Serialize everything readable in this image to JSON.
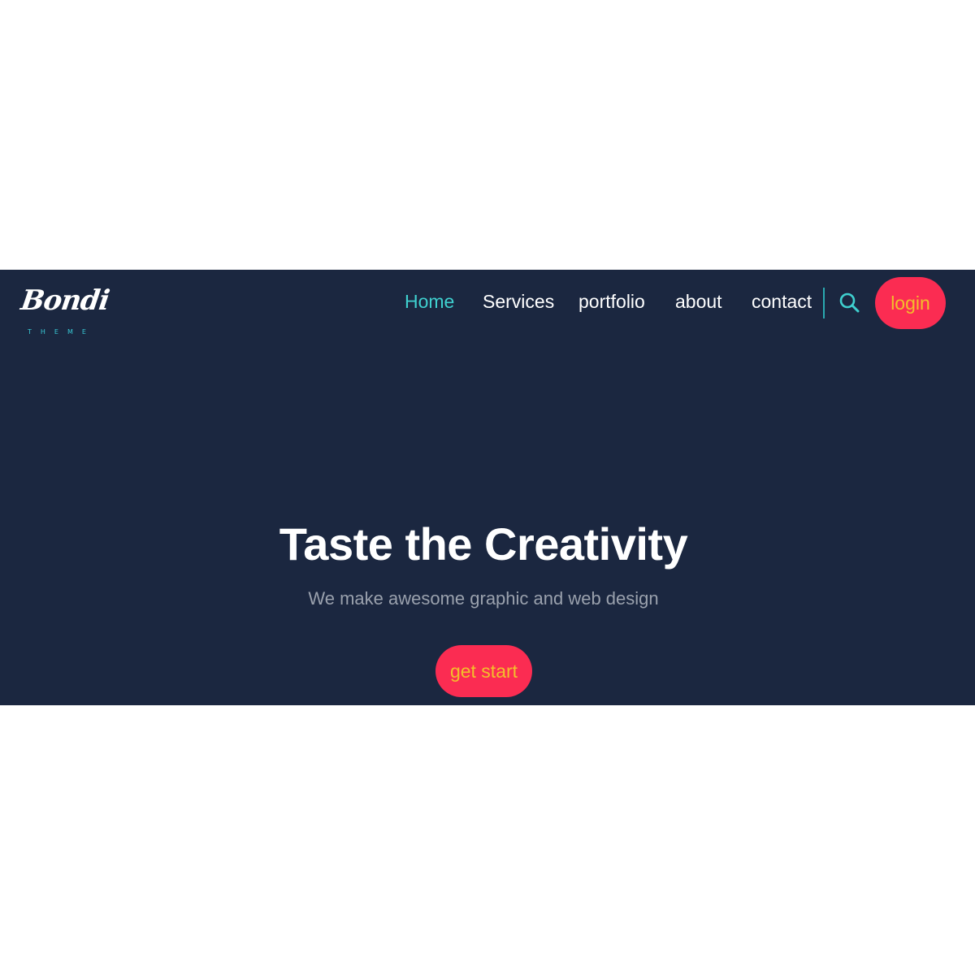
{
  "brand": {
    "name": "Bondi",
    "tagline": "THEME"
  },
  "nav": {
    "items": [
      {
        "label": "Home",
        "active": true
      },
      {
        "label": "Services",
        "active": false
      },
      {
        "label": "portfolio",
        "active": false
      },
      {
        "label": "about",
        "active": false
      },
      {
        "label": "contact",
        "active": false
      }
    ],
    "search_icon": "search-icon",
    "login_label": "login"
  },
  "hero": {
    "title": "Taste the Creativity",
    "subtitle": "We make awesome graphic and web design",
    "cta_label": "get start"
  },
  "colors": {
    "hero_background": "#1b2740",
    "accent": "#3fd0cf",
    "button_background": "#fb2c52",
    "button_text": "#f3bf2b",
    "page_background": "#ffffff"
  }
}
